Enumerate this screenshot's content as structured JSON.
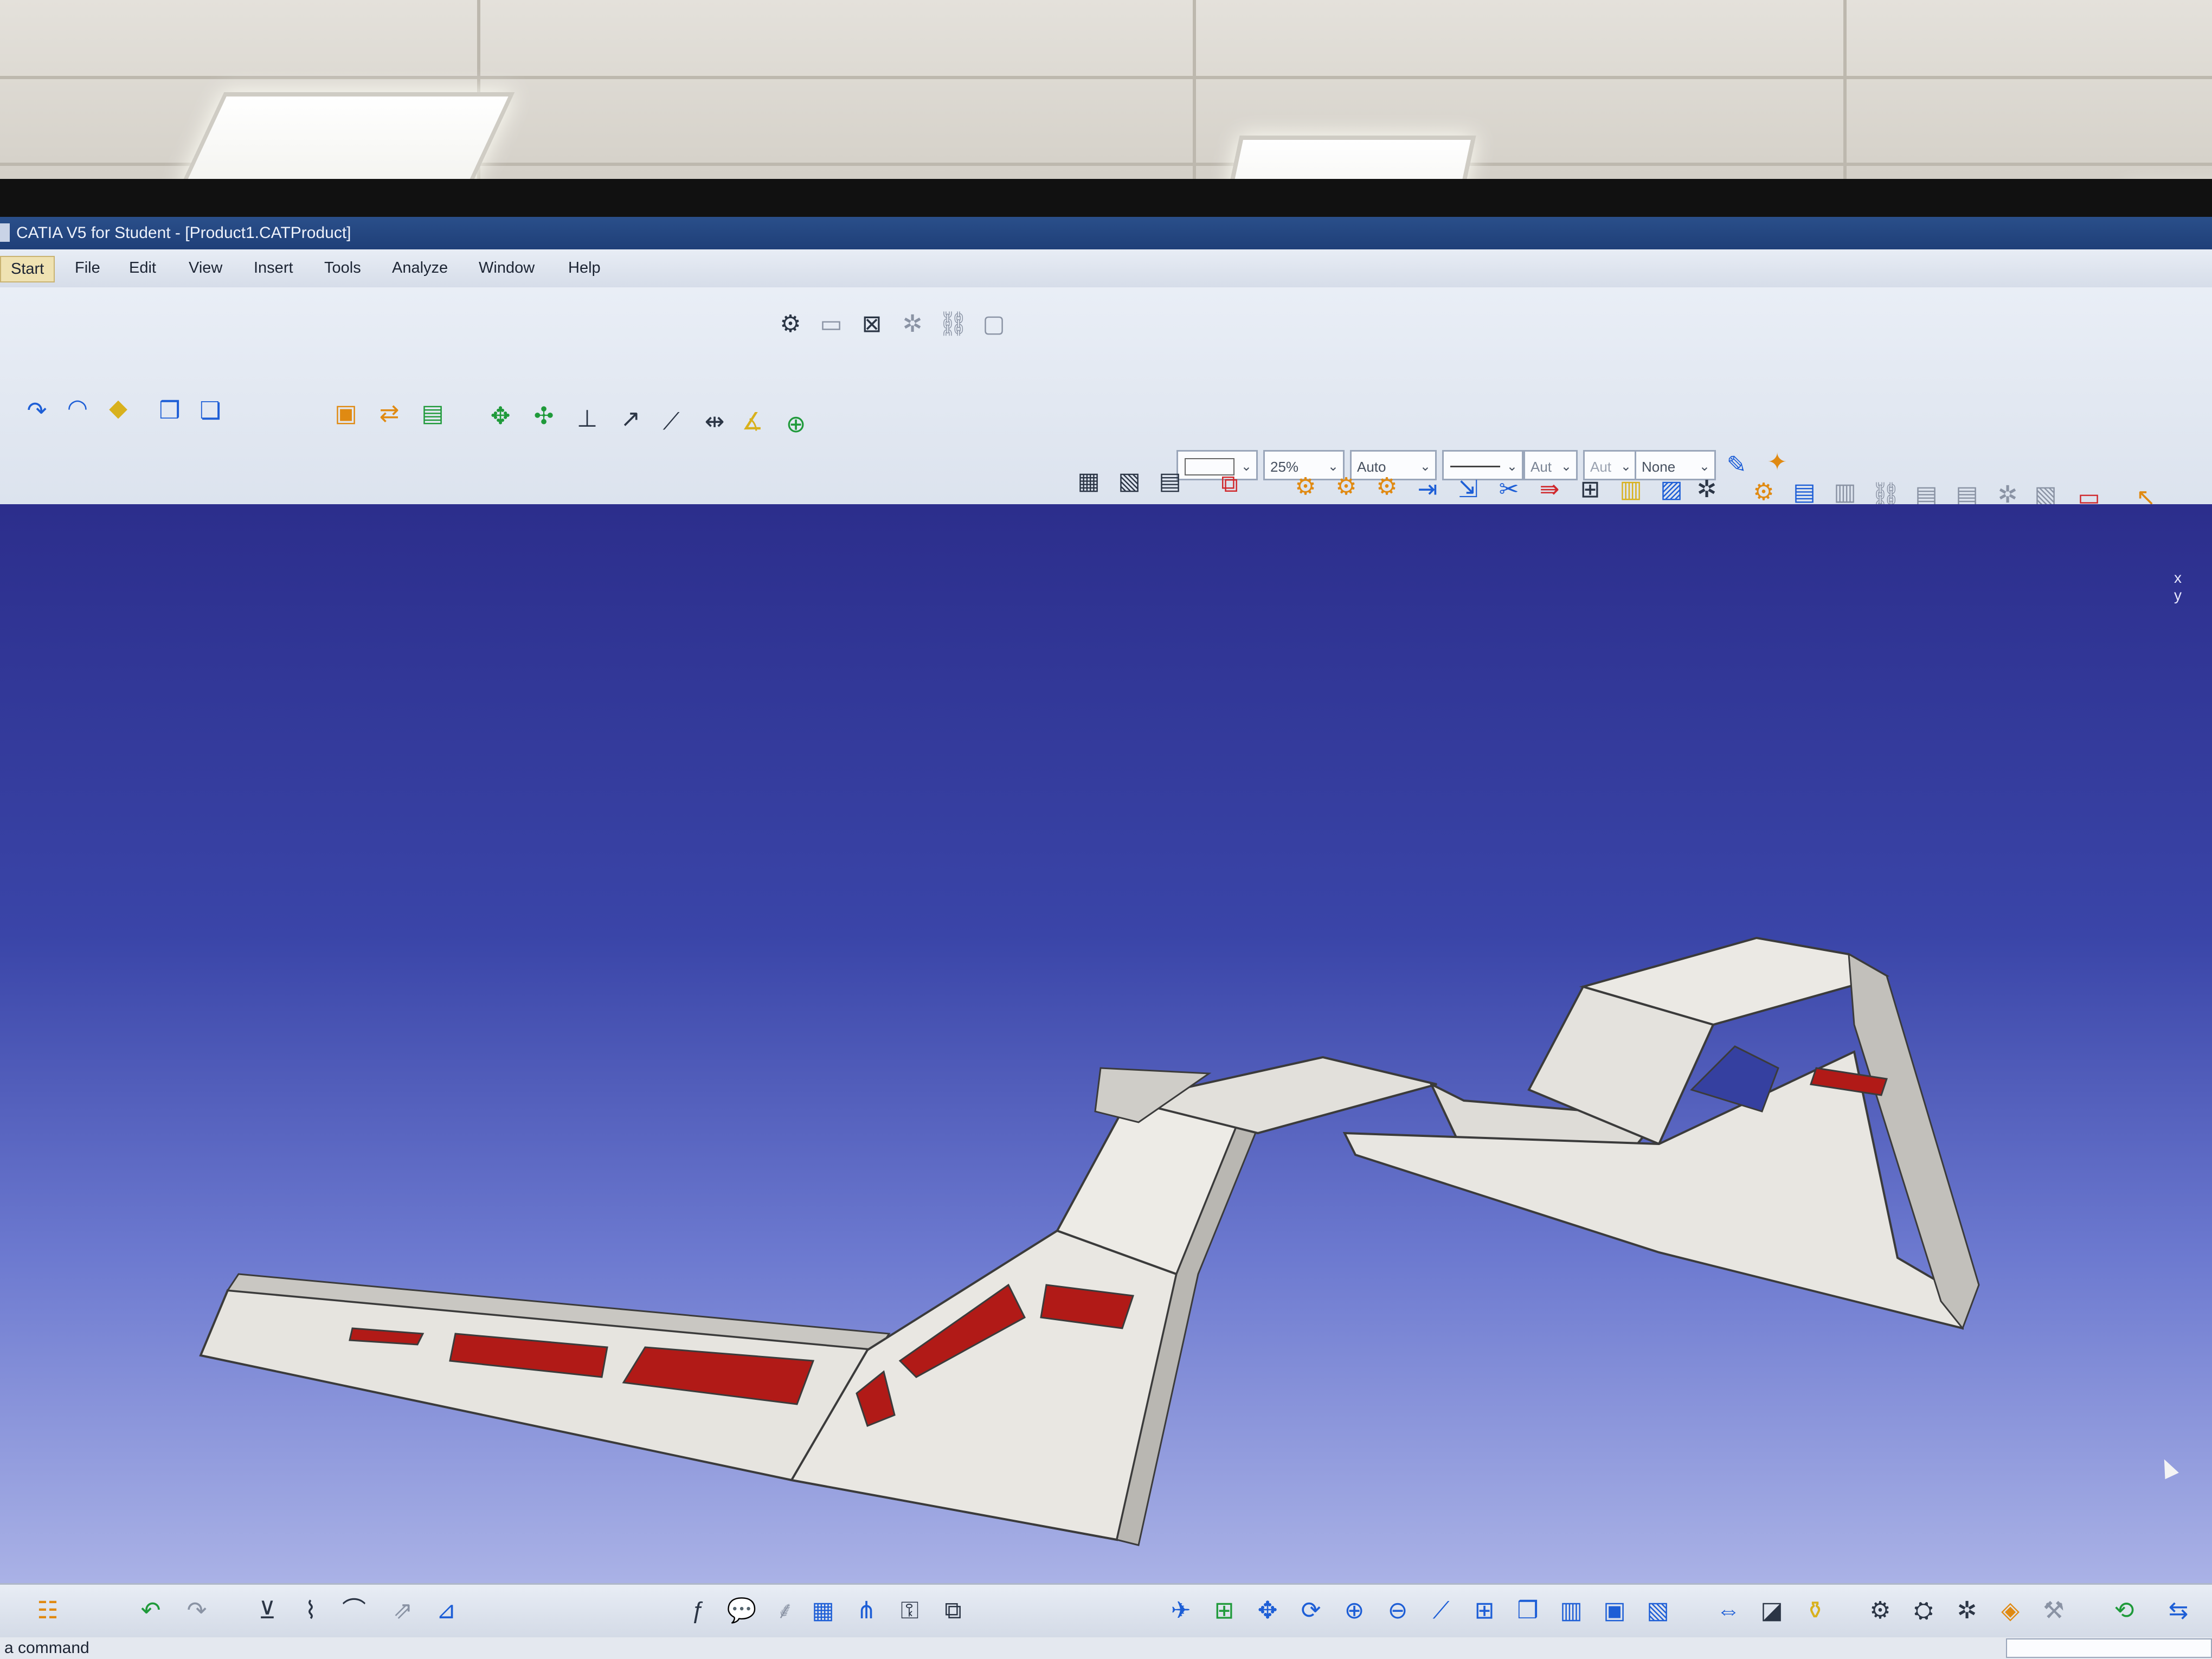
{
  "window": {
    "title": "CATIA V5 for Student - [Product1.CATProduct]"
  },
  "menu": {
    "items": [
      "Start",
      "File",
      "Edit",
      "View",
      "Insert",
      "Tools",
      "Analyze",
      "Window",
      "Help"
    ]
  },
  "graphic_properties": {
    "color": "",
    "transparency": "25%",
    "line_thickness": "Auto",
    "line_type": "",
    "point_type": "Aut",
    "point_symbol": "Aut",
    "layer": "None"
  },
  "compass_axes": {
    "x": "x",
    "y": "y"
  },
  "status": {
    "message": "a command"
  },
  "colors": {
    "viewport_top": "#2c2e8c",
    "viewport_bottom": "#aab2e6",
    "model_surface": "#e6e4df",
    "model_cutout": "#b11a17",
    "title_bar": "#1f3f78"
  },
  "icons": {
    "top_toolbar": [
      "product-icon",
      "catalog-icon",
      "measure-icon",
      "gear-icon",
      "chain-icon",
      "spec-icon"
    ],
    "left_tools": [
      "curve-icon",
      "surface-icon",
      "plane-icon",
      "body-icon",
      "part-icon",
      "insert-component-icon",
      "replace-icon",
      "reorder-icon",
      "move-icon",
      "snap-icon",
      "constraint-icon",
      "fix-icon",
      "contact-icon",
      "offset-icon",
      "angle-icon"
    ],
    "right_tools": [
      "scene-icon",
      "explode-icon",
      "clash-icon",
      "filter-icon",
      "section-icon",
      "distance-icon",
      "annotation-icon",
      "text-icon",
      "view-icon",
      "capture-icon",
      "render-icon",
      "simulation-icon",
      "pdf-icon",
      "select-arrow-icon"
    ],
    "bottom_tools": [
      "tree-expand-icon",
      "undo-icon",
      "redo-icon",
      "formula-icon",
      "comment-icon",
      "table-icon",
      "graph-icon",
      "knowledge-icon",
      "fly-icon",
      "fit-all-icon",
      "pan-icon",
      "rotate-icon",
      "zoom-in-icon",
      "zoom-out-icon",
      "normal-view-icon",
      "multi-view-icon",
      "iso-view-icon",
      "shading-icon",
      "hide-show-icon",
      "swap-icon",
      "measure-between-icon",
      "inertia-icon",
      "gravity-icon",
      "compile-icon",
      "publish-icon",
      "settings-icon",
      "refresh-icon"
    ]
  }
}
